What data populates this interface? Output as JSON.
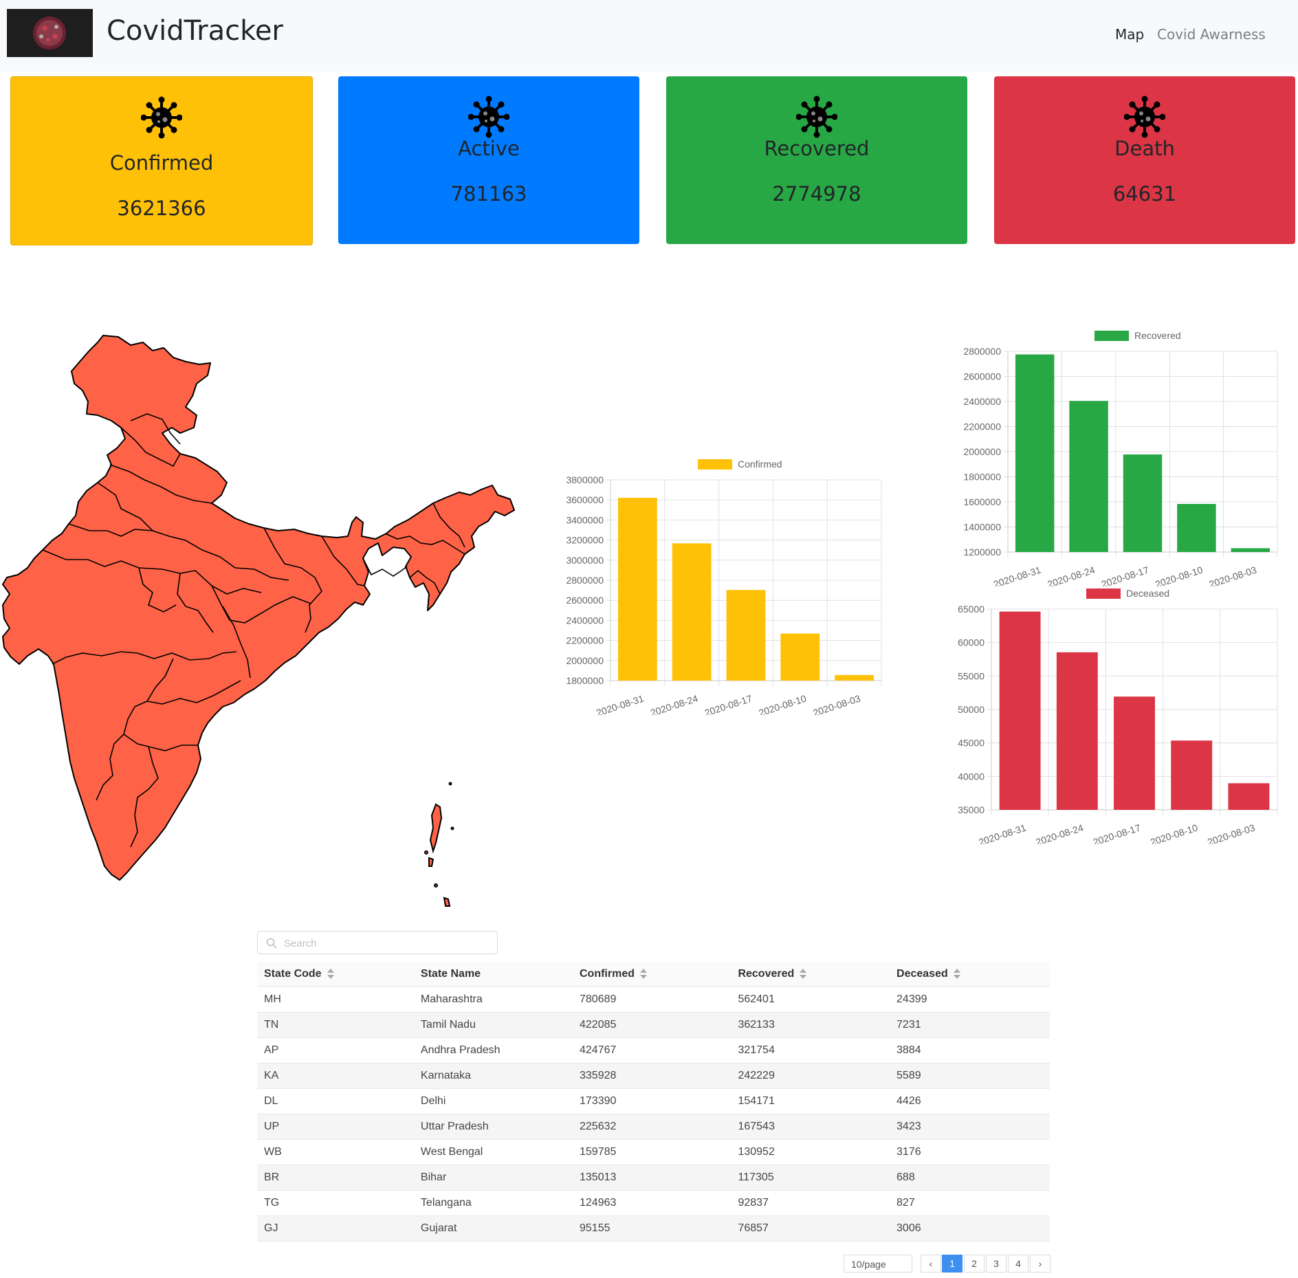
{
  "navbar": {
    "brand": "CovidTracker",
    "links": [
      "Map",
      "Covid Awarness"
    ]
  },
  "cards": [
    {
      "title": "Confirmed",
      "value": "3621366",
      "color": "#ffc107"
    },
    {
      "title": "Active",
      "value": "781163",
      "color": "#007bff"
    },
    {
      "title": "Recovered",
      "value": "2774978",
      "color": "#28a745"
    },
    {
      "title": "Death",
      "value": "64631",
      "color": "#dc3545"
    }
  ],
  "icons": {
    "card_icon": "virus-icon",
    "search_icon": "search-icon"
  },
  "map": {
    "fill": "#ff6347",
    "stroke": "#000000"
  },
  "chart_data": [
    {
      "type": "bar",
      "legend": "Confirmed",
      "color": "#ffc107",
      "categories": [
        "2020-08-31",
        "2020-08-24",
        "2020-08-17",
        "2020-08-10",
        "2020-08-03"
      ],
      "values": [
        3621366,
        3167323,
        2702742,
        2268675,
        1855745
      ],
      "ylim": [
        1800000,
        3800000
      ],
      "ystep": 200000,
      "yticks": [
        "3800000",
        "3600000",
        "3400000",
        "3200000",
        "3000000",
        "2800000",
        "2600000",
        "2400000",
        "2200000",
        "2000000",
        "1800000"
      ]
    },
    {
      "type": "bar",
      "legend": "Recovered",
      "color": "#28a745",
      "categories": [
        "2020-08-31",
        "2020-08-24",
        "2020-08-17",
        "2020-08-10",
        "2020-08-03"
      ],
      "values": [
        2774978,
        2404585,
        1977671,
        1583489,
        1230509
      ],
      "ylim": [
        1200000,
        2800000
      ],
      "ystep": 200000,
      "yticks": [
        "2800000",
        "2600000",
        "2400000",
        "2200000",
        "2000000",
        "1800000",
        "1600000",
        "1400000",
        "1200000"
      ]
    },
    {
      "type": "bar",
      "legend": "Deceased",
      "color": "#dc3545",
      "categories": [
        "2020-08-31",
        "2020-08-24",
        "2020-08-17",
        "2020-08-10",
        "2020-08-03"
      ],
      "values": [
        64631,
        58546,
        51925,
        45353,
        38976
      ],
      "ylim": [
        35000,
        65000
      ],
      "ystep": 5000,
      "yticks": [
        "65000",
        "60000",
        "55000",
        "50000",
        "45000",
        "40000",
        "35000"
      ]
    }
  ],
  "search": {
    "placeholder": "Search"
  },
  "table": {
    "columns": [
      "State Code",
      "State Name",
      "Confirmed",
      "Recovered",
      "Deceased"
    ],
    "sortable": [
      true,
      false,
      true,
      true,
      true
    ],
    "rows": [
      [
        "MH",
        "Maharashtra",
        "780689",
        "562401",
        "24399"
      ],
      [
        "TN",
        "Tamil Nadu",
        "422085",
        "362133",
        "7231"
      ],
      [
        "AP",
        "Andhra Pradesh",
        "424767",
        "321754",
        "3884"
      ],
      [
        "KA",
        "Karnataka",
        "335928",
        "242229",
        "5589"
      ],
      [
        "DL",
        "Delhi",
        "173390",
        "154171",
        "4426"
      ],
      [
        "UP",
        "Uttar Pradesh",
        "225632",
        "167543",
        "3423"
      ],
      [
        "WB",
        "West Bengal",
        "159785",
        "130952",
        "3176"
      ],
      [
        "BR",
        "Bihar",
        "135013",
        "117305",
        "688"
      ],
      [
        "TG",
        "Telangana",
        "124963",
        "92837",
        "827"
      ],
      [
        "GJ",
        "Gujarat",
        "95155",
        "76857",
        "3006"
      ]
    ]
  },
  "pagination": {
    "per_page": "10/page",
    "pages": [
      "1",
      "2",
      "3",
      "4"
    ],
    "current": "1",
    "prev": "‹",
    "next": "›"
  }
}
